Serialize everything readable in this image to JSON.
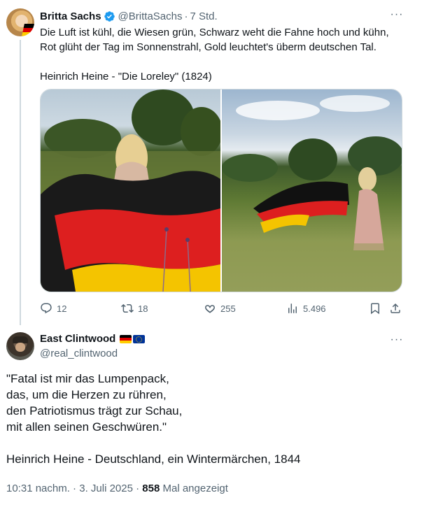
{
  "tweet1": {
    "author_name": "Britta Sachs",
    "handle": "@BrittaSachs",
    "time": "7 Std.",
    "text_lines": [
      "Die Luft ist kühl, die Wiesen grün, Schwarz weht die Fahne hoch und kühn,",
      "Rot glüht der Tag im Sonnenstrahl, Gold leuchtet's überm deutschen Tal.",
      "",
      "Heinrich Heine - \"Die Loreley\" (1824)"
    ],
    "actions": {
      "replies": "12",
      "retweets": "18",
      "likes": "255",
      "views": "5.496"
    }
  },
  "tweet2": {
    "author_name": "East Clintwood",
    "handle": "@real_clintwood",
    "text_lines": [
      "\"Fatal ist mir das Lumpenpack,",
      "das, um die Herzen zu rühren,",
      "den Patriotismus trägt zur Schau,",
      "mit allen seinen Geschwüren.\"",
      "",
      "Heinrich Heine - Deutschland, ein Wintermärchen, 1844"
    ],
    "timestamp": "10:31 nachm. · 3. Juli 2025 · ",
    "view_count": "858",
    "view_suffix": "Mal angezeigt"
  },
  "colors": {
    "text": "#0f1419",
    "secondary": "#536471",
    "verified": "#1d9bf0",
    "divider": "#cfd9de"
  },
  "icons": [
    "verified-badge-icon",
    "more-icon",
    "reply-icon",
    "retweet-icon",
    "like-icon",
    "views-icon",
    "bookmark-icon",
    "share-icon"
  ]
}
